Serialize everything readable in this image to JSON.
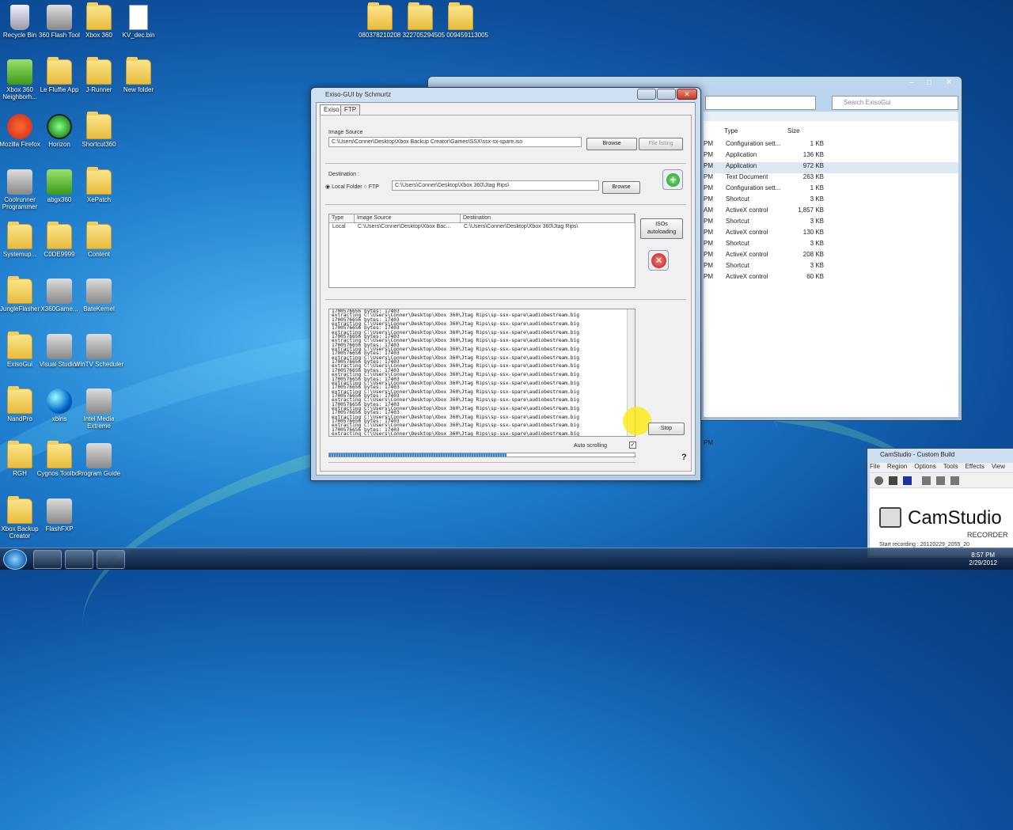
{
  "desktop_icons": [
    {
      "label": "Recycle Bin",
      "icon": "recycle-bin-icon"
    },
    {
      "label": "360 Flash Tool",
      "icon": "flash-tool-icon"
    },
    {
      "label": "Xbox 360",
      "icon": "folder-icon"
    },
    {
      "label": "KV_dec.bin",
      "icon": "file-icon"
    },
    {
      "label": "Xbox 360 Neighborh...",
      "icon": "xbox-neighborhood-icon"
    },
    {
      "label": "Le Fluffie App",
      "icon": "folder-icon"
    },
    {
      "label": "J-Runner",
      "icon": "folder-icon"
    },
    {
      "label": "New folder",
      "icon": "folder-icon"
    },
    {
      "label": "Mozilla Firefox",
      "icon": "firefox-icon"
    },
    {
      "label": "Horizon",
      "icon": "horizon-icon"
    },
    {
      "label": "Shortcut360",
      "icon": "folder-icon"
    },
    {
      "label": "Coolrunner Programmer",
      "icon": "coolrunner-icon"
    },
    {
      "label": "abgx360",
      "icon": "abgx360-icon"
    },
    {
      "label": "XePatch",
      "icon": "folder-icon"
    },
    {
      "label": "Systemup...",
      "icon": "folder-icon"
    },
    {
      "label": "C0DE9999",
      "icon": "folder-icon"
    },
    {
      "label": "Content",
      "icon": "folder-icon"
    },
    {
      "label": "JungleFlasher",
      "icon": "folder-icon"
    },
    {
      "label": "X360Game...",
      "icon": "x360game-icon"
    },
    {
      "label": "BateKernel",
      "icon": "batekernel-icon"
    },
    {
      "label": "ExisoGui",
      "icon": "folder-icon"
    },
    {
      "label": "Visual Studios",
      "icon": "visual-studio-icon"
    },
    {
      "label": "WinTV Scheduler",
      "icon": "wintv-scheduler-icon"
    },
    {
      "label": "NandPro",
      "icon": "folder-icon"
    },
    {
      "label": "xbins",
      "icon": "globe-icon"
    },
    {
      "label": "Intel Media Extreme",
      "icon": "intel-media-icon"
    },
    {
      "label": "RGH",
      "icon": "folder-icon"
    },
    {
      "label": "Cygnos Toolbox",
      "icon": "folder-icon"
    },
    {
      "label": "Program Guide",
      "icon": "titan-icon"
    },
    {
      "label": "Xbox Backup Creator",
      "icon": "folder-icon"
    },
    {
      "label": "FlashFXP",
      "icon": "flashfxp-icon"
    }
  ],
  "top_folders": [
    {
      "label": "080378210208 322705294505 009459113005"
    }
  ],
  "explorer": {
    "search_placeholder": "Search ExisoGui",
    "columns": {
      "type": "Type",
      "size": "Size"
    },
    "rows": [
      {
        "time": "PM",
        "type": "Configuration sett...",
        "size": "1 KB"
      },
      {
        "time": "PM",
        "type": "Application",
        "size": "136 KB"
      },
      {
        "time": "PM",
        "type": "Application",
        "size": "972 KB"
      },
      {
        "time": "PM",
        "type": "Text Document",
        "size": "263 KB"
      },
      {
        "time": "PM",
        "type": "Configuration sett...",
        "size": "1 KB"
      },
      {
        "time": "PM",
        "type": "Shortcut",
        "size": "3 KB"
      },
      {
        "time": "AM",
        "type": "ActiveX control",
        "size": "1,857 KB"
      },
      {
        "time": "PM",
        "type": "Shortcut",
        "size": "3 KB"
      },
      {
        "time": "PM",
        "type": "ActiveX control",
        "size": "130 KB"
      },
      {
        "time": "PM",
        "type": "Shortcut",
        "size": "3 KB"
      },
      {
        "time": "PM",
        "type": "ActiveX control",
        "size": "208 KB"
      },
      {
        "time": "PM",
        "type": "Shortcut",
        "size": "3 KB"
      },
      {
        "time": "PM",
        "type": "ActiveX control",
        "size": "60 KB"
      }
    ],
    "bottom_text": "PM"
  },
  "exiso": {
    "title": "Exiso-GUI by Schmurtz",
    "tabs": [
      "Exiso",
      "FTP"
    ],
    "image_source_label": "Image Source",
    "image_source_value": "C:\\Users\\Conner\\Desktop\\Xbox Backup Creator\\Games\\SSX\\ssx-sx-spare.iso",
    "browse": "Browse",
    "file_listing": "File listing",
    "destination_label": "Destination :",
    "local_folder": "Local Folder",
    "ftp": "FTP",
    "destination_value": "C:\\Users\\Conner\\Desktop\\Xbox 360\\Jtag Rips\\",
    "queue_headers": [
      "Type",
      "Image Source",
      "Destination"
    ],
    "queue_row": [
      "Local",
      "C:\\Users\\Conner\\Desktop\\Xbox Bac...",
      "C:\\Users\\Conner\\Desktop\\Xbox 360\\Jtag Rips\\"
    ],
    "isos_autoloading": "ISOs autoloading",
    "log_line_a": "1700576656 bytes: 17403",
    "log_line_b": "extracting C:\\Users\\Conner\\Desktop\\Xbox 360\\Jtag Rips\\sp-ssx-spare\\audiobestream.big",
    "auto_scrolling": "Auto scrolling",
    "stop": "Stop",
    "help": "?",
    "progress": 0.58
  },
  "camstudio": {
    "title": "CamStudio - Custom Build",
    "menu": [
      "File",
      "Region",
      "Options",
      "Tools",
      "Effects",
      "View"
    ],
    "logo": "CamStudio",
    "sub": "RECORDER",
    "status": "Start recording : 20120229_2055_20"
  },
  "taskbar": {
    "time": "8:57 PM",
    "date": "2/29/2012"
  }
}
